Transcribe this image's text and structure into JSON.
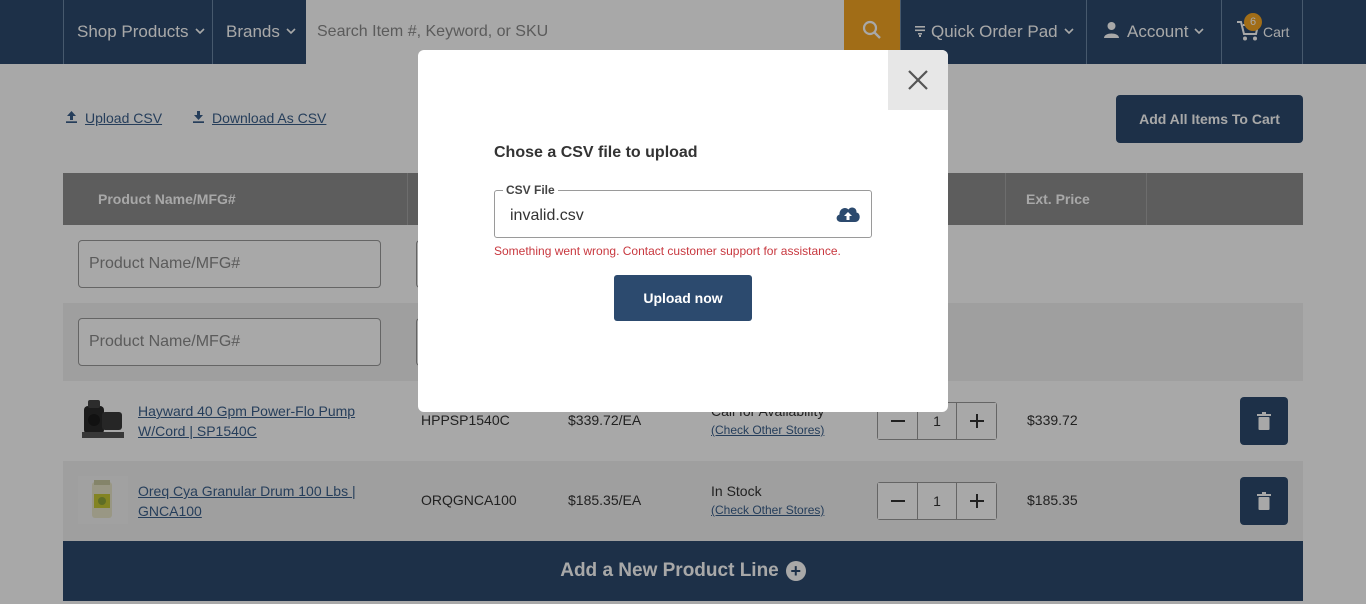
{
  "header": {
    "shop_products": "Shop Products",
    "brands": "Brands",
    "search_placeholder": "Search Item #, Keyword, or SKU",
    "quick_order_pad": "Quick Order Pad",
    "account": "Account",
    "cart_label": "Cart",
    "cart_count": "6"
  },
  "toolbar": {
    "upload_csv": "Upload CSV",
    "download_csv": "Download As CSV",
    "add_all": "Add All Items To Cart"
  },
  "table": {
    "col_product": "Product Name/MFG#",
    "col_ext_price": "Ext. Price",
    "entry_placeholder": "Product Name/MFG#",
    "rows": [
      {
        "name": "Hayward 40 Gpm Power-Flo Pump W/Cord | SP1540C",
        "sku": "HPPSP1540C",
        "price": "$339.72/EA",
        "availability": "Call for Availability",
        "check_stores": "(Check Other Stores)",
        "qty": "1",
        "ext_price": "$339.72"
      },
      {
        "name": "Oreq Cya Granular Drum 100 Lbs | GNCA100",
        "sku": "ORQGNCA100",
        "price": "$185.35/EA",
        "availability": "In Stock",
        "check_stores": "(Check Other Stores)",
        "qty": "1",
        "ext_price": "$185.35"
      }
    ],
    "add_line": "Add a New Product Line"
  },
  "modal": {
    "title": "Chose a CSV file to upload",
    "field_label": "CSV File",
    "file_value": "invalid.csv",
    "error": "Something went wrong. Contact customer support for assistance.",
    "submit": "Upload now"
  },
  "colors": {
    "primary": "#2c4a6e",
    "accent": "#f5a623",
    "error": "#c8383f"
  },
  "icons": [
    "chevron-down-icon",
    "search-icon",
    "list-icon",
    "user-icon",
    "cart-icon",
    "upload-icon",
    "download-icon",
    "trash-icon",
    "plus-circle-icon",
    "close-icon",
    "cloud-upload-icon"
  ]
}
